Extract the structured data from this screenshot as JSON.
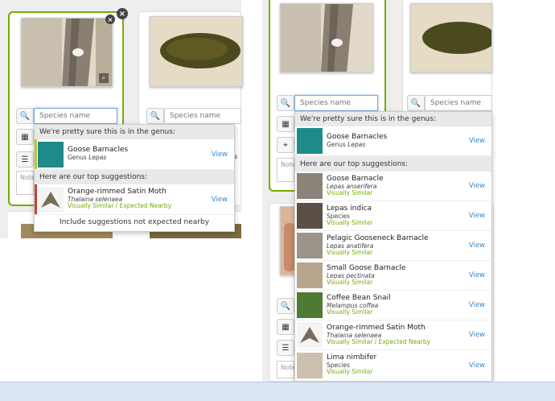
{
  "left": {
    "species_placeholder": "Species name",
    "note_placeholder": "Notes",
    "behind_text": "gs",
    "dropdown": {
      "genus_header": "We're pretty sure this is in the genus:",
      "genus_result": {
        "name": "Goose Barnacles",
        "rank": "Genus",
        "sci": "Lepas",
        "view": "View"
      },
      "suggestions_header": "Here are our top suggestions:",
      "suggestions": [
        {
          "name": "Orange-rimmed Satin Moth",
          "sci": "Thalaina selenaea",
          "tag": "Visually Similar",
          "tag_sep": " / ",
          "tag2": "Expected Nearby",
          "view": "View"
        }
      ],
      "footer": "Include suggestions not expected nearby"
    }
  },
  "right": {
    "species_placeholder": "Species name",
    "species_placeholder_2": "Species name",
    "note_placeholder": "Note",
    "dropdown": {
      "genus_header": "We're pretty sure this is in the genus:",
      "genus_result": {
        "name": "Goose Barnacles",
        "rank": "Genus",
        "sci": "Lepas",
        "view": "View"
      },
      "suggestions_header": "Here are our top suggestions:",
      "suggestions": [
        {
          "name": "Goose Barnacle",
          "sci": "Lepas anserifera",
          "tag": "Visually Similar",
          "view": "View"
        },
        {
          "name": "Lepas indica",
          "sci": "Species",
          "plain": true,
          "tag": "Visually Similar",
          "view": "View"
        },
        {
          "name": "Pelagic Gooseneck Barnacle",
          "sci": "Lepas anatifera",
          "tag": "Visually Similar",
          "view": "View"
        },
        {
          "name": "Small Goose Barnacle",
          "sci": "Lepas pectinata",
          "tag": "Visually Similar",
          "view": "View"
        },
        {
          "name": "Coffee Bean Snail",
          "sci": "Melampus coffea",
          "tag": "Visually Similar",
          "view": "View"
        },
        {
          "name": "Orange-rimmed Satin Moth",
          "sci": "Thalaina selenaea",
          "tag": "Visually Similar",
          "tag_sep": " / ",
          "tag2": "Expected Nearby",
          "view": "View"
        },
        {
          "name": "Lima nimbifer",
          "sci": "Species",
          "plain": true,
          "tag": "Visually Similar",
          "view": "View"
        }
      ]
    }
  },
  "colors": {
    "accent_green": "#74ac00",
    "link_blue": "#3a87c8",
    "genus_stripe": "#b5c43a",
    "nearby_stripe": "#c2403a"
  },
  "icons": [
    "search-icon",
    "calendar-icon",
    "list-icon",
    "map-marker-icon",
    "close-icon",
    "zoom-icon"
  ]
}
